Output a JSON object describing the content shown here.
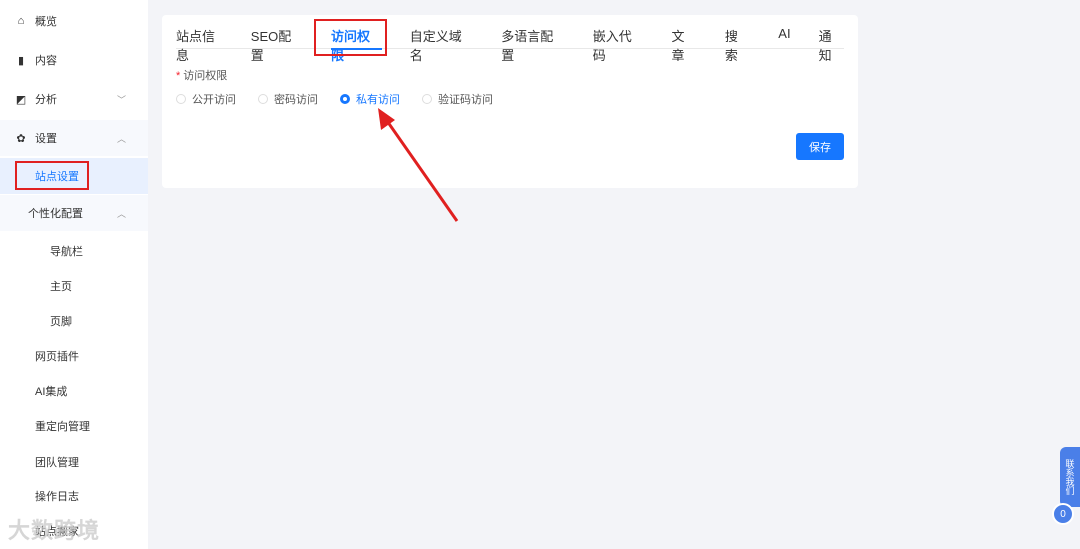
{
  "sidebar": {
    "items": [
      {
        "label": "概览",
        "icon": "home-icon"
      },
      {
        "label": "内容",
        "icon": "book-icon"
      },
      {
        "label": "分析",
        "icon": "chart-icon"
      },
      {
        "label": "设置",
        "icon": "gear-icon"
      },
      {
        "label": "站点设置"
      },
      {
        "label": "个性化配置"
      },
      {
        "label": "导航栏"
      },
      {
        "label": "主页"
      },
      {
        "label": "页脚"
      },
      {
        "label": "网页插件"
      },
      {
        "label": "AI集成"
      },
      {
        "label": "重定向管理"
      },
      {
        "label": "团队管理"
      },
      {
        "label": "操作日志"
      },
      {
        "label": "站点搬家"
      }
    ]
  },
  "tabs": [
    "站点信息",
    "SEO配置",
    "访问权限",
    "自定义域名",
    "多语言配置",
    "嵌入代码",
    "文章",
    "搜索",
    "AI",
    "通知"
  ],
  "form": {
    "required_mark": "*",
    "label": "访问权限",
    "options": [
      "公开访问",
      "密码访问",
      "私有访问",
      "验证码访问"
    ],
    "selected": "私有访问",
    "save": "保存"
  },
  "float": {
    "contact": "联系我们",
    "badge": "0"
  },
  "watermark": "大数跨境",
  "colors": {
    "accent": "#1677ff",
    "annotation": "#e02020"
  }
}
